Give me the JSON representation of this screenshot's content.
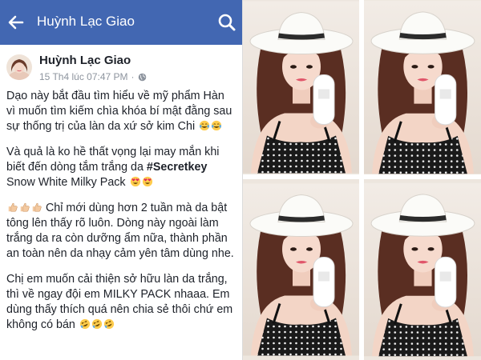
{
  "header": {
    "title": "Huỳnh Lạc Giao",
    "back_icon": "arrow-left-icon",
    "search_icon": "search-icon",
    "bar_color": "#4267b2"
  },
  "post": {
    "author": "Huỳnh Lạc Giao",
    "date": "15 Th4 lúc 07:47 PM",
    "separator": "·",
    "privacy_icon": "globe-icon",
    "paragraphs": {
      "p1": {
        "l1": "Dạo này bắt đầu tìm hiểu về mỹ phẩm Hàn",
        "l2": "vì muốn tìm kiếm chìa khóa bí mật đằng sau",
        "l3": "sự thống trị của làn da xứ sở kim Chi"
      },
      "p2": {
        "l1": "Và quả là ko hề thất vọng lại may mắn khi",
        "l2": "biết đến dòng tắm trắng da",
        "l2_tag": "#Secretkey",
        "l3": "Snow White Milky Pack"
      },
      "p3": {
        "l1": "Chỉ mới dùng hơn 2 tuần mà da bật",
        "l2": "tông lên thấy rõ luôn. Dòng này ngoài làm",
        "l3": "trắng da ra còn dưỡng ẩm nữa, thành phần",
        "l4": "an toàn nên da nhạy cảm yên tâm dùng nhe."
      },
      "p4": {
        "l1": "Chị em muốn cải thiện sở hữu làn da trắng,",
        "l2": "thì về ngay đội em MILKY PACK nhaaa. Em",
        "l3": "dùng thấy thích quá nên chia sẻ thôi chứ em",
        "l4": "không có bán"
      }
    },
    "emojis": [
      "tears-of-joy-emoji",
      "heart-eyes-emoji",
      "thumbs-up-emoji",
      "rolling-laughing-emoji"
    ]
  },
  "colors": {
    "link_blue": "#4267b2",
    "text": "#1d2129",
    "meta": "#8d949e",
    "emoji_yellow": "#ffcc4d",
    "heart_red": "#e0245e"
  },
  "photos": [
    {
      "name": "photo-top-left",
      "subject": "woman in white sun hat holding white bottle"
    },
    {
      "name": "photo-top-right",
      "subject": "woman in white sun hat holding white bottle"
    },
    {
      "name": "photo-bottom-left",
      "subject": "woman in white sun hat holding white bottle"
    },
    {
      "name": "photo-bottom-right",
      "subject": "woman in white sun hat holding white bottle"
    }
  ]
}
